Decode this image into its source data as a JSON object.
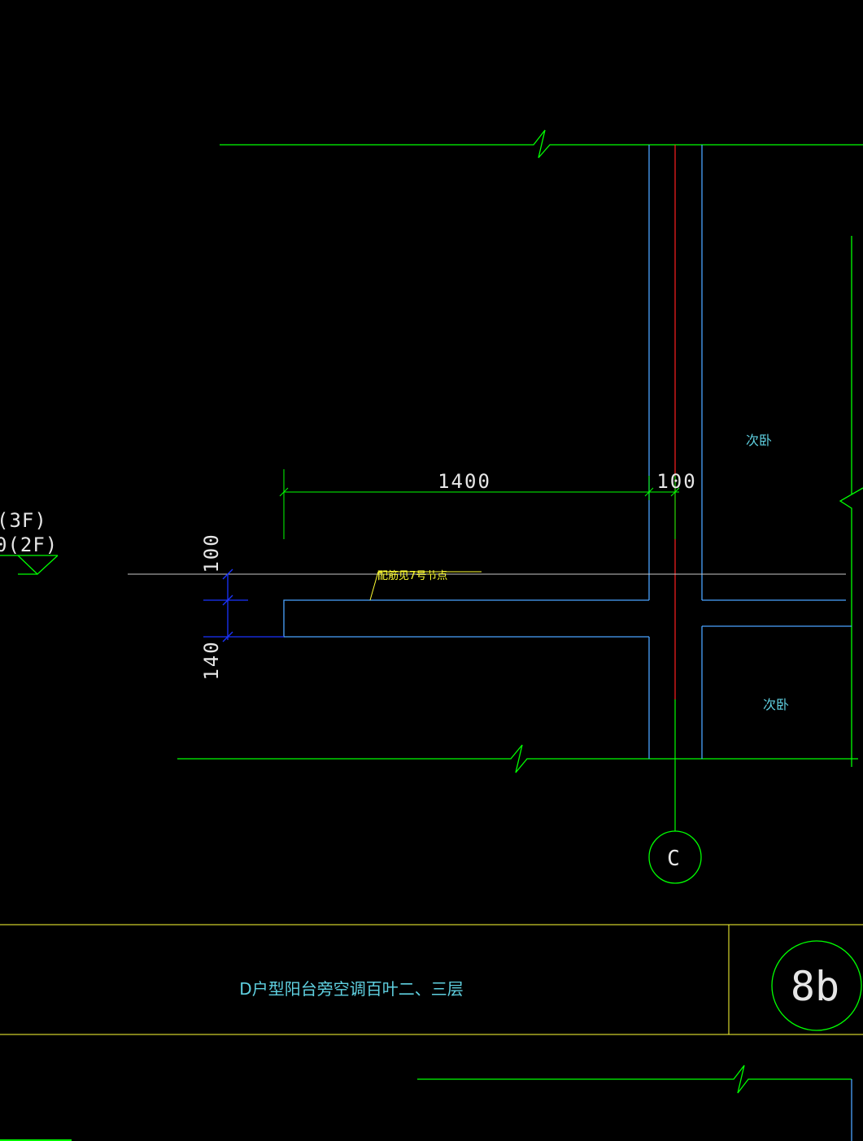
{
  "level_marks": {
    "upper": "(3F)",
    "lower": "0(2F)"
  },
  "dimensions": {
    "horizontal_long": "1400",
    "horizontal_short": "100",
    "vertical_top": "100",
    "vertical_bottom": "140"
  },
  "annotation": {
    "note": "配筋见7号节点"
  },
  "rooms": {
    "upper": "次卧",
    "lower": "次卧"
  },
  "axis": {
    "label": "C"
  },
  "title_block": {
    "title": "D户型阳台旁空调百叶二、三层",
    "sheet_number": "8b"
  },
  "colors": {
    "background": "#000000",
    "green": "#00ff00",
    "slab_blue": "#4aa3ff",
    "dark_blue": "#1a33ff",
    "red_axis": "#ff2020",
    "grey_line": "#c8c8c8",
    "yellow": "#ffff33",
    "cyan_text": "#5fd0e0",
    "white_text": "#e6e6e6"
  }
}
